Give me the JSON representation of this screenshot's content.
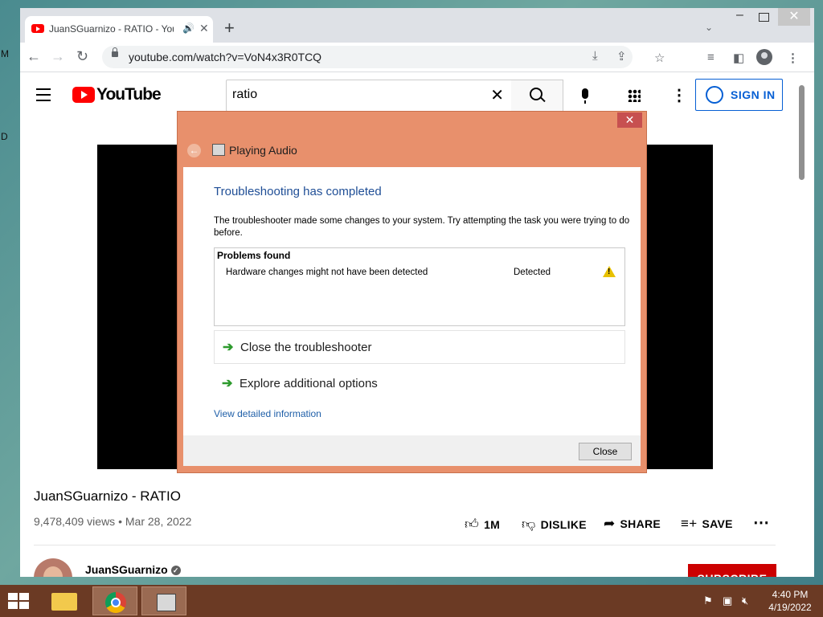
{
  "desktop": {
    "left_letter_1": "M",
    "left_letter_2": "D"
  },
  "browser": {
    "tab_title": "JuanSGuarnizo - RATIO - YouTube",
    "url": "youtube.com/watch?v=VoN4x3R0TCQ"
  },
  "youtube": {
    "logo_text": "YouTube",
    "search_query": "ratio",
    "sign_in_label": "SIGN IN",
    "video_title": "JuanSGuarnizo - RATIO",
    "views": "9,478,409 views",
    "date": "Mar 28, 2022",
    "likes_label": "1M",
    "dislike_label": "DISLIKE",
    "share_label": "SHARE",
    "save_label": "SAVE",
    "channel_name": "JuanSGuarnizo",
    "subscribe_label": "SUBSCRIBE"
  },
  "dialog": {
    "title": "Playing Audio",
    "heading": "Troubleshooting has completed",
    "description": "The troubleshooter made some changes to your system. Try attempting the task you were trying to do before.",
    "problems_header": "Problems found",
    "problems": [
      {
        "name": "Hardware changes might not have been detected",
        "status": "Detected",
        "icon": "warning-icon"
      }
    ],
    "option_close": "Close the troubleshooter",
    "option_explore": "Explore additional options",
    "detail_link": "View detailed information",
    "close_button": "Close"
  },
  "taskbar": {
    "time": "4:40 PM",
    "date": "4/19/2022"
  }
}
